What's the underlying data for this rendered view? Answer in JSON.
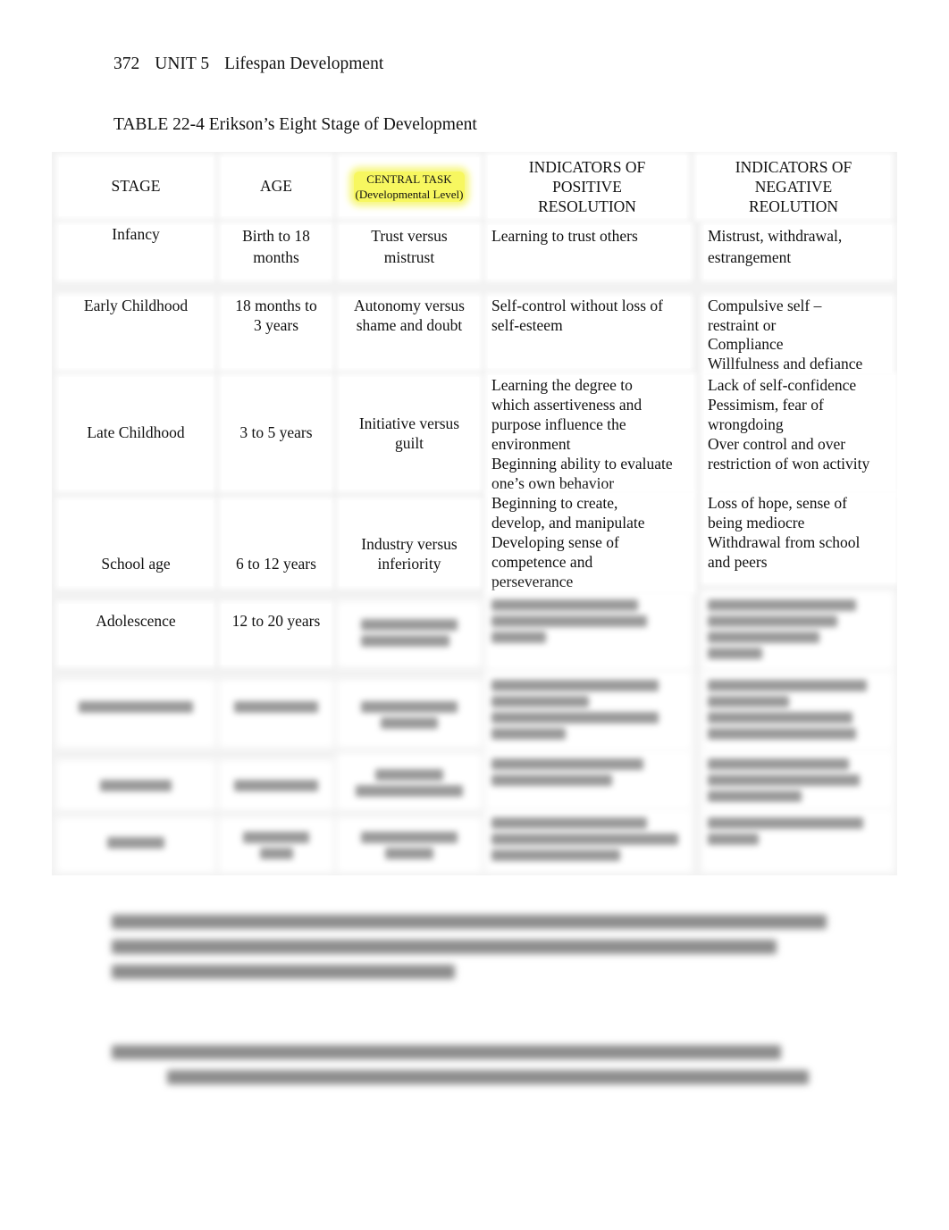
{
  "running_head": {
    "page_number": "372",
    "unit": "UNIT 5",
    "section": "Lifespan Development"
  },
  "table": {
    "title": "TABLE 22-4 Erikson’s Eight Stage of Development",
    "headers": {
      "stage": "STAGE",
      "age": "AGE",
      "central_task": "CENTRAL TASK",
      "central_task_sub": "(Developmental Level)",
      "positive": "INDICATORS OF\nPOSITIVE\nRESOLUTION",
      "negative": "INDICATORS OF\nNEGATIVE\nREOLUTION"
    },
    "highlight_color": "#f7f760",
    "rows": [
      {
        "stage": "Infancy",
        "age": "Birth to 18\nmonths",
        "task": "Trust versus\nmistrust",
        "positive": "Learning to trust others",
        "negative": "Mistrust, withdrawal,\nestrangement"
      },
      {
        "stage": "Early Childhood",
        "age": "18 months to\n3 years",
        "task": "Autonomy versus\nshame and doubt",
        "positive": "Self-control without loss of\nself-esteem",
        "negative": "Compulsive self –\nrestraint or\n Compliance\nWillfulness and defiance"
      },
      {
        "stage": "Late Childhood",
        "age": "3 to 5 years",
        "task": "Initiative versus\nguilt",
        "positive": "Learning the degree to\nwhich assertiveness and\npurpose influence the\nenvironment\nBeginning ability to evaluate\none’s own behavior",
        "negative": "Lack of self-confidence\nPessimism, fear of\nwrongdoing\nOver control and over\nrestriction of won activity"
      },
      {
        "stage": "School age",
        "age": "6 to 12 years",
        "task": "Industry versus\ninferiority",
        "positive": "Beginning to create,\ndevelop, and manipulate\nDeveloping sense of\ncompetence and\nperseverance",
        "negative": "Loss of hope, sense of\nbeing mediocre\nWithdrawal from school\nand peers"
      },
      {
        "stage": "Adolescence",
        "age": "12 to 20 years",
        "task": null,
        "positive": null,
        "negative": null,
        "blurred": true
      },
      {
        "blurred_row": true
      },
      {
        "blurred_row": true
      },
      {
        "blurred_row": true
      }
    ]
  },
  "footer": {
    "blurred": true
  }
}
